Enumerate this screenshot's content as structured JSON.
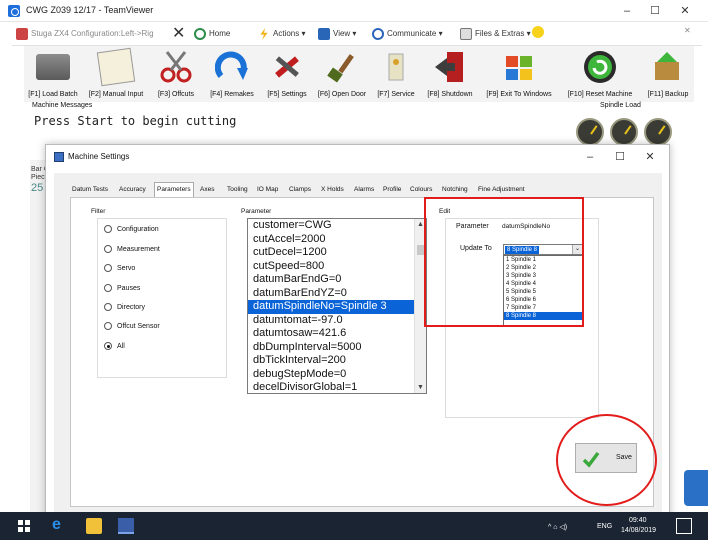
{
  "teamviewer": {
    "title": "CWG Z039 12/17 - TeamViewer",
    "window_controls": {
      "minimize": "–",
      "maximize": "☐",
      "close": "✕"
    },
    "session_tab": "Stuga ZX4   Configuration:Left->Rig",
    "toolbar": {
      "home": "Home",
      "actions": "Actions ▾",
      "view": "View ▾",
      "communicate": "Communicate ▾",
      "files": "Files & Extras ▾"
    }
  },
  "app": {
    "toolbar": [
      {
        "label": "[F1] Load Batch",
        "icon": "folder-icon"
      },
      {
        "label": "[F2] Manual Input",
        "icon": "notepad-icon"
      },
      {
        "label": "[F3] Offcuts",
        "icon": "scissors-icon"
      },
      {
        "label": "[F4] Remakes",
        "icon": "refresh-icon"
      },
      {
        "label": "[F5] Settings",
        "icon": "tools-icon"
      },
      {
        "label": "[F6] Open Door",
        "icon": "brush-icon"
      },
      {
        "label": "[F7] Service",
        "icon": "service-icon"
      },
      {
        "label": "[F8] Shutdown",
        "icon": "exit-door-icon"
      },
      {
        "label": "[F9] Exit To Windows",
        "icon": "windows-icon"
      },
      {
        "label": "[F10] Reset Machine",
        "icon": "reset-icon"
      },
      {
        "label": "[F11] Backup",
        "icon": "backup-icon"
      }
    ],
    "machine_messages_label": "Machine Messages",
    "machine_message": "Press Start to begin cutting",
    "spindle_load_label": "Spindle Load",
    "bg_labels": {
      "bar": "Bar C",
      "piece": "Piece",
      "value": "25"
    }
  },
  "dialog": {
    "title": "Machine Settings",
    "tabs": [
      "Datum Tests",
      "Accuracy",
      "Parameters",
      "Axes",
      "Tooling",
      "IO Map",
      "Clamps",
      "X Holds",
      "Alarms",
      "Profile",
      "Colours",
      "Notching",
      "Fine Adjustment"
    ],
    "active_tab": "Parameters",
    "filter": {
      "label": "Filter",
      "options": [
        "Configuration",
        "Measurement",
        "Servo",
        "Pauses",
        "Directory",
        "Offcut Sensor",
        "All"
      ],
      "selected": "All"
    },
    "parameter": {
      "label": "Parameter",
      "items": [
        "customer=CWG",
        "cutAccel=2000",
        "cutDecel=1200",
        "cutSpeed=800",
        "datumBarEndG=0",
        "datumBarEndYZ=0",
        "datumSpindleNo=Spindle 3",
        "datumtomat=-97.0",
        "datumtosaw=421.6",
        "dbDumpInterval=5000",
        "dbTickInterval=200",
        "debugStepMode=0",
        "decelDivisorGlobal=1"
      ],
      "selected": "datumSpindleNo=Spindle 3"
    },
    "edit": {
      "label": "Edit",
      "parameter_label": "Parameter",
      "parameter_value": "datumSpindleNo",
      "update_label": "Update To",
      "dropdown_value": "8 Spindle 8",
      "dropdown_options": [
        "1 Spindle 1",
        "2 Spindle 2",
        "3 Spindle 3",
        "4 Spindle 4",
        "5 Spindle 5",
        "6 Spindle 6",
        "7 Spindle 7",
        "8 Spindle 8"
      ],
      "dropdown_selected": "8 Spindle 8"
    },
    "save_label": "Save"
  },
  "taskbar": {
    "time": "09:40",
    "date": "14/08/2019",
    "language": "ENG",
    "tray": "^ ⌂ ◁) "
  },
  "colors": {
    "annotation_red": "#e21b1b",
    "selection_blue": "#0a64d8",
    "taskbar": "#1b2433"
  }
}
